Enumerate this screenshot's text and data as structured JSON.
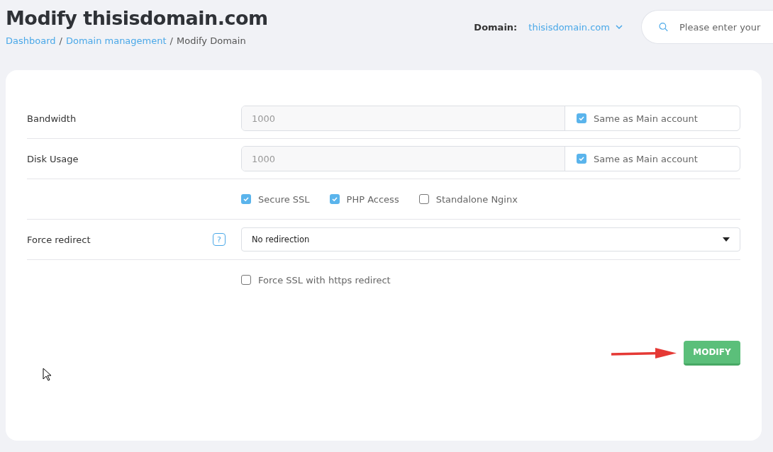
{
  "header": {
    "title": "Modify thisisdomain.com",
    "breadcrumb_separator": "/",
    "breadcrumb": [
      {
        "label": "Dashboard",
        "link": true
      },
      {
        "label": "Domain management",
        "link": true
      },
      {
        "label": "Modify Domain",
        "link": false
      }
    ],
    "domain_selector": {
      "label": "Domain:",
      "value": "thisisdomain.com"
    },
    "search": {
      "placeholder": "Please enter your"
    }
  },
  "form": {
    "rows": [
      {
        "kind": "quota",
        "label": "Bandwidth",
        "placeholder": "1000",
        "option": {
          "label": "Same as Main account",
          "checked": true
        }
      },
      {
        "kind": "quota",
        "label": "Disk Usage",
        "placeholder": "1000",
        "option": {
          "label": "Same as Main account",
          "checked": true
        }
      },
      {
        "kind": "checks",
        "options": [
          {
            "label": "Secure SSL",
            "checked": true
          },
          {
            "label": "PHP Access",
            "checked": true
          },
          {
            "label": "Standalone Nginx",
            "checked": false
          }
        ]
      },
      {
        "kind": "select",
        "label": "Force redirect",
        "help": "?",
        "value": "No redirection"
      },
      {
        "kind": "checks",
        "options": [
          {
            "label": "Force SSL with https redirect",
            "checked": false
          }
        ]
      }
    ],
    "submit": "MODIFY"
  }
}
